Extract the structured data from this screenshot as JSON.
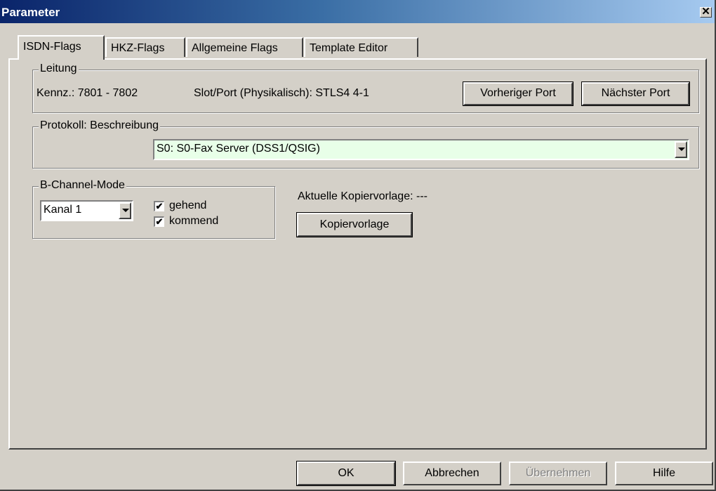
{
  "window": {
    "title": "Parameter",
    "close_glyph": "✕"
  },
  "tabs": [
    {
      "label": "ISDN-Flags",
      "active": true
    },
    {
      "label": "HKZ-Flags",
      "active": false
    },
    {
      "label": "Allgemeine Flags",
      "active": false
    },
    {
      "label": "Template Editor",
      "active": false
    }
  ],
  "leitung": {
    "legend": "Leitung",
    "kennz": "Kennz.: 7801 - 7802",
    "slot_port": "Slot/Port (Physikalisch): STLS4  4-1",
    "prev_port_label": "Vorheriger Port",
    "next_port_label": "Nächster Port"
  },
  "protokoll": {
    "legend": "Protokoll: Beschreibung",
    "selected": "S0: S0-Fax Server (DSS1/QSIG)",
    "bg_color": "#e8ffe8"
  },
  "bchannel": {
    "legend": "B-Channel-Mode",
    "kanal_selected": "Kanal 1",
    "gehend_label": "gehend",
    "gehend_checked": true,
    "kommend_label": "kommend",
    "kommend_checked": true
  },
  "kopiervorlage": {
    "current_label": "Aktuelle Kopiervorlage:  ---",
    "button_label": "Kopiervorlage"
  },
  "footer": {
    "ok_label": "OK",
    "cancel_label": "Abbrechen",
    "apply_label": "Übernehmen",
    "apply_enabled": false,
    "help_label": "Hilfe"
  },
  "icons": {
    "checkbox_check": "✔",
    "dropdown": "chevron-down-icon"
  }
}
